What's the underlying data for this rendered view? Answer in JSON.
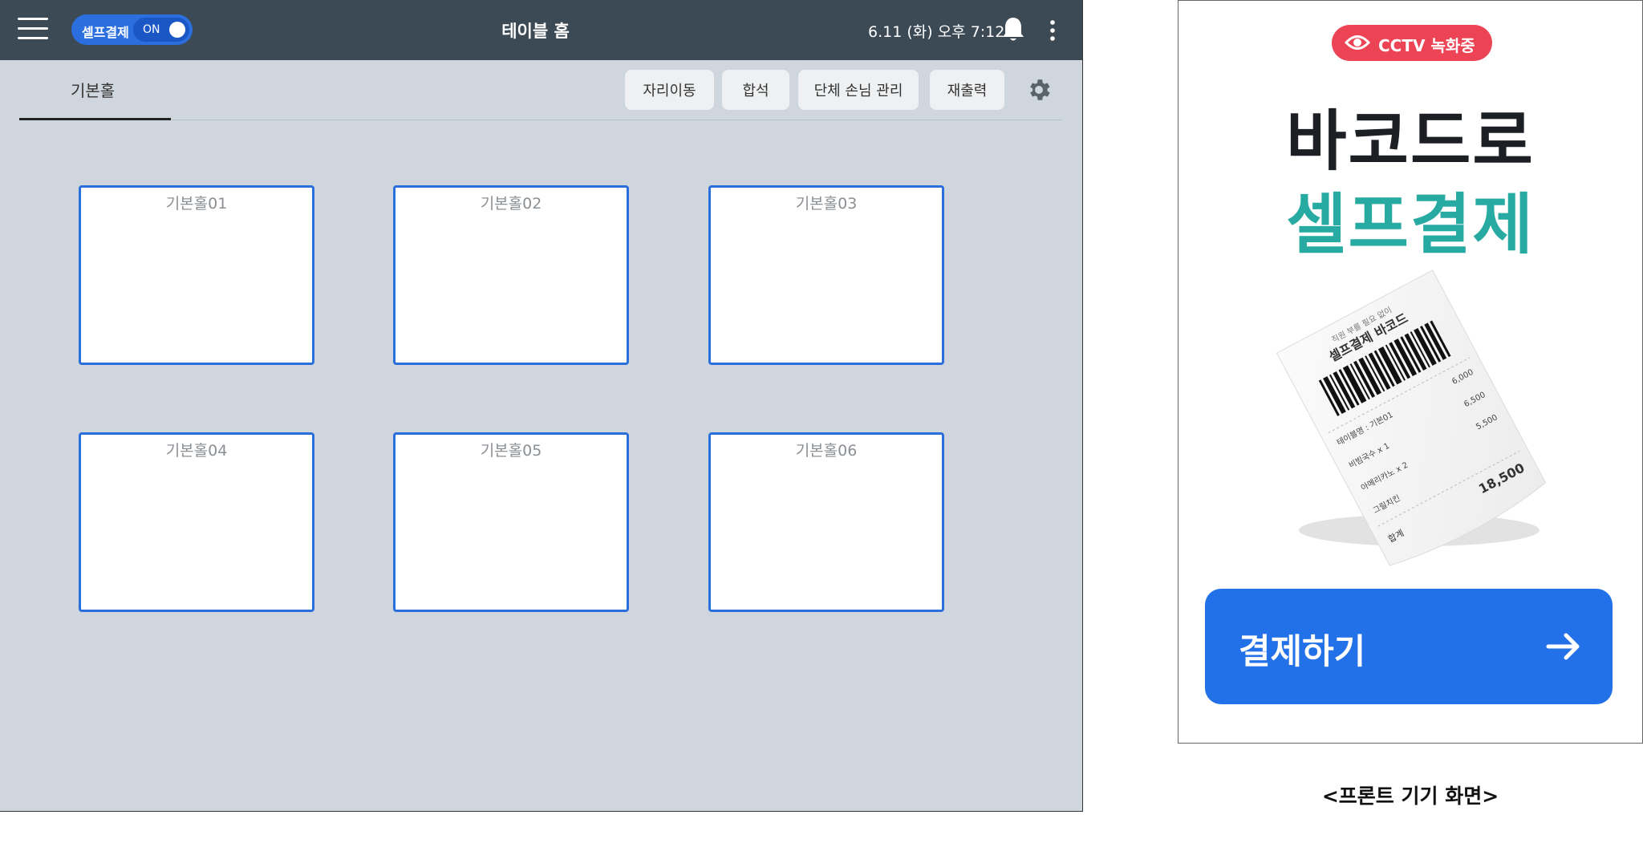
{
  "pos": {
    "topbar": {
      "self_checkout_label": "셀프결제",
      "self_checkout_state": "ON",
      "title": "테이블 홈",
      "datetime": "6.11 (화) 오후 7:12"
    },
    "tab": {
      "label": "기본홀"
    },
    "toolbar": {
      "move_seat": "자리이동",
      "merge": "합석",
      "group_guests": "단체 손님 관리",
      "reprint": "재출력"
    },
    "tables": [
      "기본홀01",
      "기본홀02",
      "기본홀03",
      "기본홀04",
      "기본홀05",
      "기본홀06"
    ],
    "colors": {
      "topbar": "#3c4a56",
      "background": "#d0d6dd",
      "table_border": "#2a6fdb",
      "toggle": "#2b6fdf"
    }
  },
  "device": {
    "cctv_badge": "CCTV 녹화중",
    "headline_line1": "바코드로",
    "headline_line2": "셀프결제",
    "receipt": {
      "subtitle": "직원 부를 필요 없이",
      "title": "셀프결제 바코드",
      "table": "테이블명 : 기본01",
      "item1": "비빔국수 x 1",
      "price1": "6,000",
      "price1b": "6,500",
      "item2": "아메리카노 x 2",
      "price2": "5,500",
      "item3": "그릴치킨",
      "total_label": "합계",
      "total": "18,500"
    },
    "pay_button": "결제하기",
    "colors": {
      "cctv": "#ec4455",
      "headline_accent": "#26aaa1",
      "pay_button": "#2371e8"
    }
  },
  "caption": "<프론트 기기 화면>"
}
